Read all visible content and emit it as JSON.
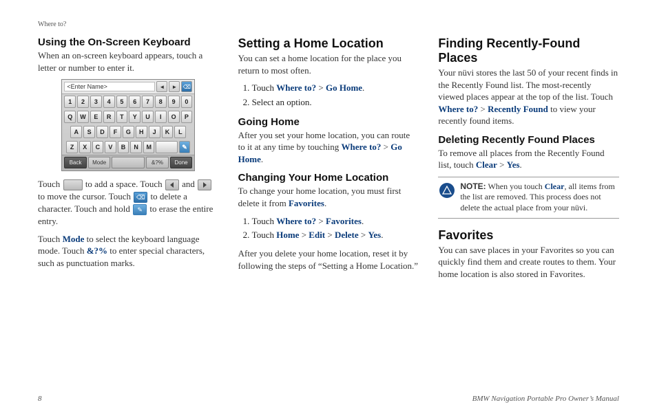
{
  "header": {
    "breadcrumb": "Where to?"
  },
  "col1": {
    "h1": "Using the On-Screen Keyboard",
    "intro": "When an on-screen keyboard appears, touch a letter or number to enter it.",
    "kb": {
      "placeholder": "<Enter Name>",
      "row_num": [
        "1",
        "2",
        "3",
        "4",
        "5",
        "6",
        "7",
        "8",
        "9",
        "0"
      ],
      "row_a": [
        "Q",
        "W",
        "E",
        "R",
        "T",
        "Y",
        "U",
        "I",
        "O",
        "P"
      ],
      "row_b": [
        "A",
        "S",
        "D",
        "F",
        "G",
        "H",
        "J",
        "K",
        "L"
      ],
      "row_c": [
        "Z",
        "X",
        "C",
        "V",
        "B",
        "N",
        "M"
      ],
      "btn_back": "Back",
      "btn_mode": "Mode",
      "btn_sym": "&?%",
      "btn_done": "Done"
    },
    "p2a": "Touch ",
    "p2b": " to add a space. Touch ",
    "p2c": " and ",
    "p2d": " to move the cursor. Touch ",
    "p2e": " to delete a character. Touch and hold ",
    "p2f": " to erase the entire entry.",
    "p3a": "Touch ",
    "p3_mode": "Mode",
    "p3b": " to select the keyboard language mode. Touch ",
    "p3_sym": "&?%",
    "p3c": " to enter special characters, such as punctuation marks."
  },
  "col2": {
    "h1a": "Setting a Home Location",
    "p1": "You can set a home location for the place you return to most often.",
    "ol1_1a": "Touch ",
    "link_where": "Where to?",
    "gt": " > ",
    "link_gohome": "Go Home",
    "ol1_2": "Select an option.",
    "h2a": "Going Home",
    "p2a": "After you set your home location, you can route to it at any time by touching ",
    "h2b": "Changing Your Home Location",
    "p3a": "To change your home location, you must first delete it from ",
    "link_fav": "Favorites",
    "ol2_1a": "Touch ",
    "ol2_2a": "Touch ",
    "link_home": "Home",
    "link_edit": "Edit",
    "link_delete": "Delete",
    "link_yes": "Yes",
    "p4": "After you delete your home location, reset it by following the steps of “Setting a Home Location.”"
  },
  "col3": {
    "h1a": "Finding Recently-Found Places",
    "p1a": "Your nüvi stores the last 50 of your recent finds in the Recently Found list. The most-recently viewed places appear at the top of the list. Touch ",
    "link_where": "Where to?",
    "gt": " > ",
    "link_recent": "Recently Found",
    "p1b": " to view your recently found items.",
    "h2a": "Deleting Recently Found Places",
    "p2a": "To remove all places from the Recently Found list, touch ",
    "link_clear": "Clear",
    "link_yes": "Yes",
    "note_label": "NOTE:",
    "note_a": " When you touch ",
    "note_b": ", all items from the list are removed. This process does not delete the actual place from your nüvi.",
    "h1b": "Favorites",
    "p3": "You can save places in your Favorites so you can quickly find them and create routes to them. Your home location is also stored in Favorites."
  },
  "footer": {
    "page": "8",
    "title": "BMW Navigation Portable Pro Owner’s Manual"
  }
}
